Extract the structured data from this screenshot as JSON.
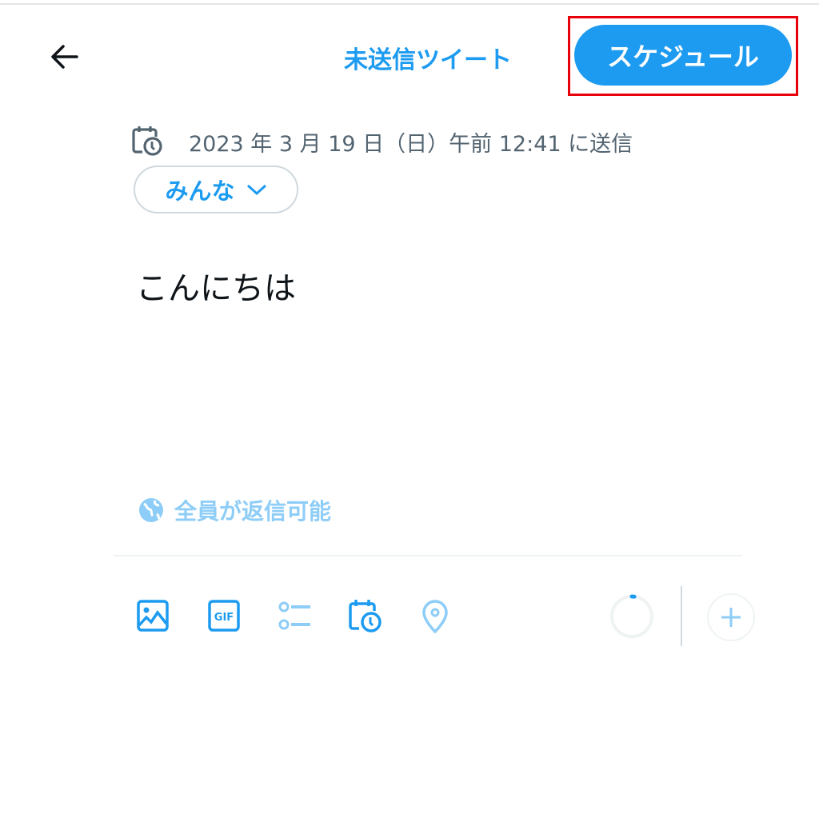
{
  "header": {
    "title": "未送信ツイート",
    "schedule_label": "スケジュール"
  },
  "schedule": {
    "text": "2023 年 3 月 19 日（日）午前 12:41 に送信"
  },
  "audience": {
    "label": "みんな"
  },
  "tweet": {
    "text": "こんにちは"
  },
  "reply_setting": {
    "label": "全員が返信可能"
  },
  "toolbar": {
    "icons": [
      "image-icon",
      "gif-icon",
      "poll-icon",
      "schedule-icon",
      "location-icon"
    ],
    "char_progress_percent": 2
  },
  "colors": {
    "accent": "#1d9bf0",
    "highlight": "#e8000b",
    "accent_light": "#8ecdf7"
  }
}
